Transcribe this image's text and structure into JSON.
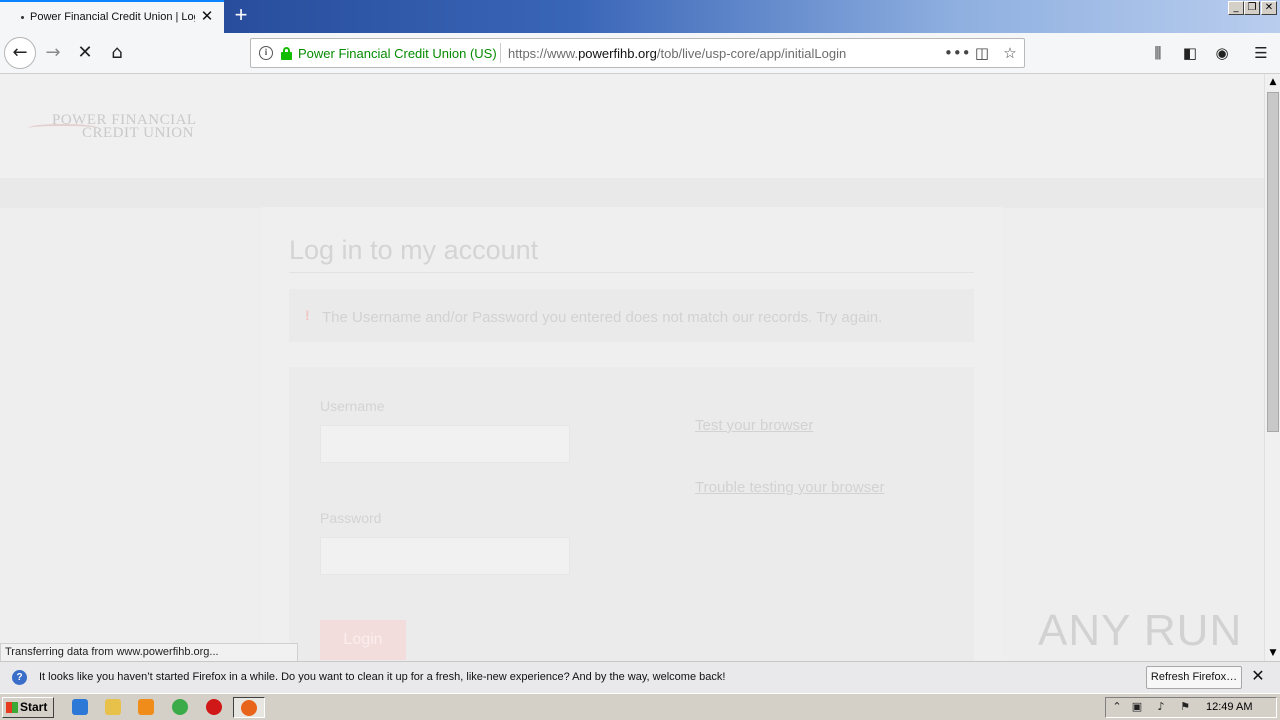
{
  "browser": {
    "tab_title": "Power Financial Credit Union | Login",
    "new_tab": "+",
    "url_org": "Power Financial Credit Union (US)",
    "url_prefix": "https://www.",
    "url_domain": "powerfihb.org",
    "url_path": "/tob/live/usp-core/app/initialLogin",
    "status_text": "Transferring data from www.powerfihb.org..."
  },
  "page": {
    "logo_line1": "POWER FINANCIAL",
    "logo_line2": "CREDIT UNION",
    "heading": "Log in to my account",
    "error_icon": "!",
    "error_message": "The Username and/or Password you entered does not match our records. Try again.",
    "username_label": "Username",
    "password_label": "Password",
    "test_browser_link": "Test your browser",
    "trouble_link": "Trouble testing your browser",
    "login_button": "Login"
  },
  "notification": {
    "message": "It looks like you haven’t started Firefox in a while. Do you want to clean it up for a fresh, like-new experience? And by the way, welcome back!",
    "refresh_button": "Refresh Firefox…"
  },
  "taskbar": {
    "start_label": "Start",
    "clock": "12:49 AM"
  },
  "watermark": "ANY RUN",
  "colors": {
    "accent": "#0a84ff",
    "secure_green": "#058b00",
    "titlebar_blue": "#1c3d8a"
  }
}
